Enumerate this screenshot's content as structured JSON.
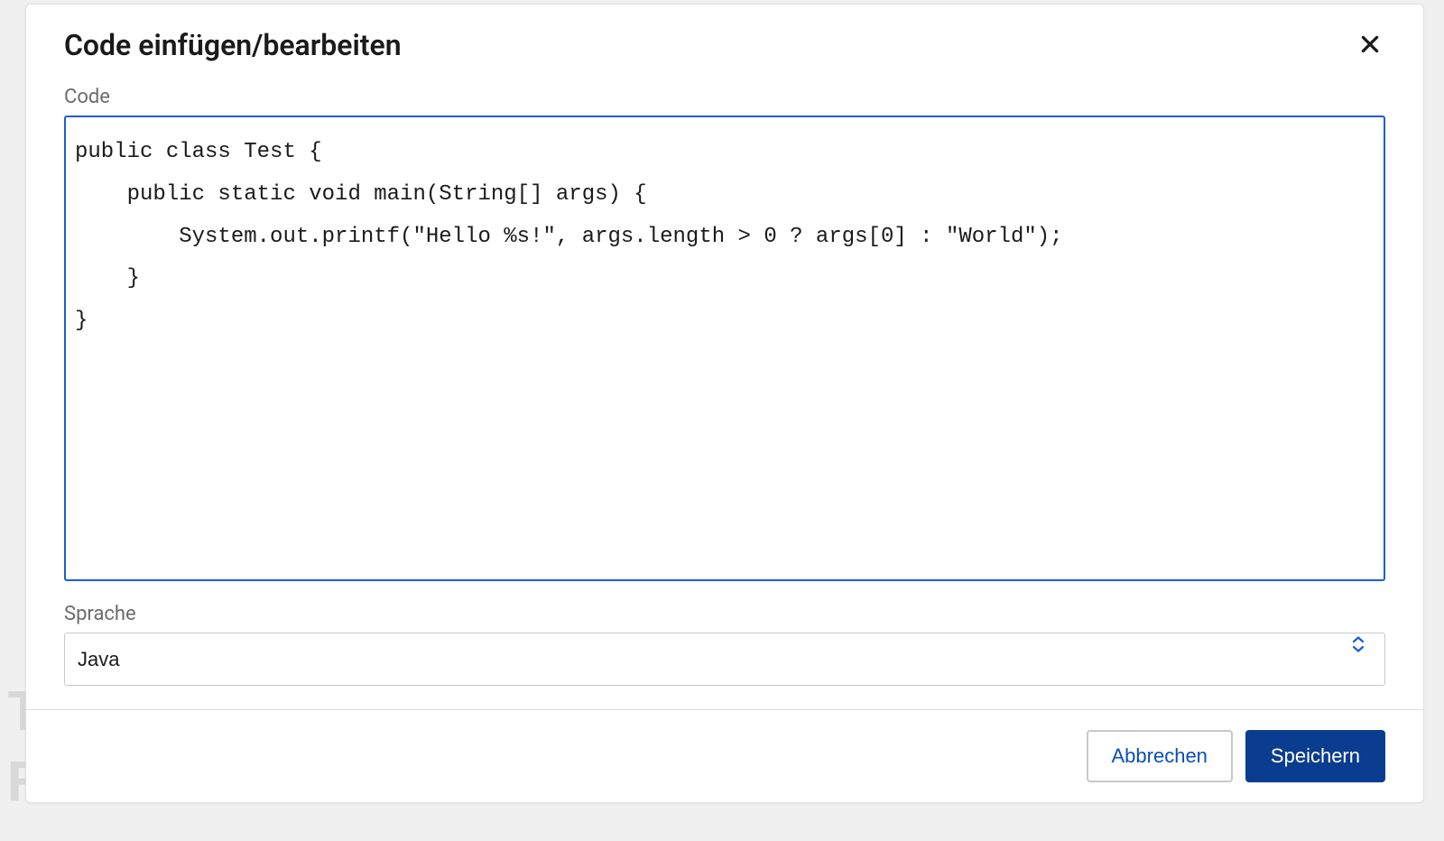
{
  "dialog": {
    "title": "Code einfügen/bearbeiten",
    "code_label": "Code",
    "code_value": "public class Test {\n    public static void main(String[] args) {\n        System.out.printf(\"Hello %s!\", args.length > 0 ? args[0] : \"World\");\n    }\n}",
    "language_label": "Sprache",
    "language_value": "Java",
    "cancel_label": "Abbrechen",
    "save_label": "Speichern"
  }
}
